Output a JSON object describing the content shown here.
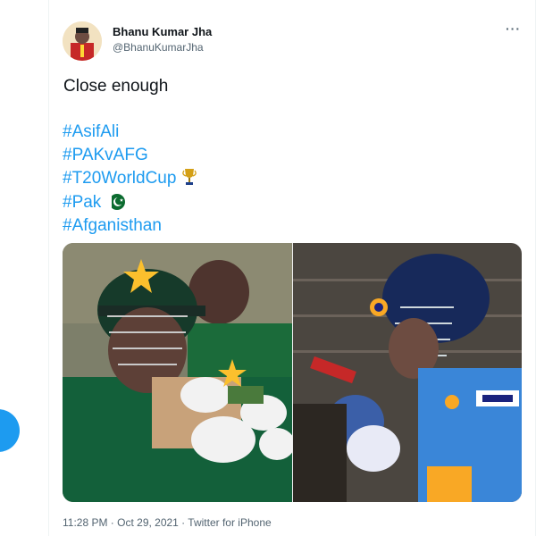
{
  "author": {
    "name": "Bhanu Kumar Jha",
    "handle": "@BhanuKumarJha"
  },
  "tweet": {
    "text": "Close enough",
    "hashtags": [
      "#AsifAli",
      "#PAKvAFG",
      "#T20WorldCup",
      "#Pak",
      "#Afganisthan"
    ],
    "meta": "11:28 PM · Oct 29, 2021 · Twitter for iPhone"
  },
  "icons": {
    "more": "more-options-icon",
    "trophy": "trophy-emoji",
    "flag": "pakistan-flag-emoji"
  },
  "colors": {
    "accent": "#1d9bf0",
    "text": "#0f1419",
    "muted": "#536471"
  }
}
